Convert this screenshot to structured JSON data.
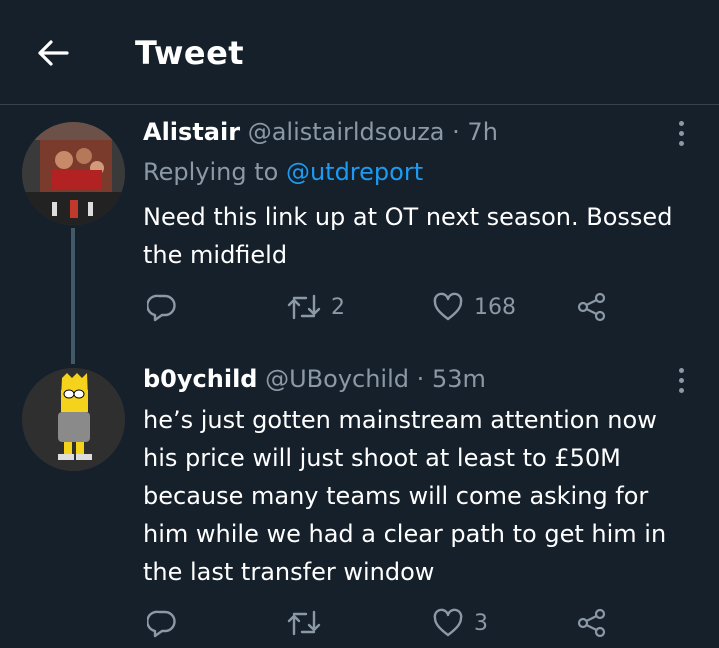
{
  "header": {
    "title": "Tweet",
    "back_icon": "arrow-left-icon"
  },
  "tweets": [
    {
      "name": "Alistair",
      "handle": "@alistairldsouza",
      "sep": "·",
      "time": "7h",
      "replying_prefix": "Replying to",
      "replying_handle": "@utdreport",
      "text_lines": [
        "Need this link up at OT next season. Bossed",
        "the midfield"
      ],
      "reply_count": "",
      "retweet_count": "2",
      "like_count": "168"
    },
    {
      "name": "b0ychild",
      "handle": "@UBoychild",
      "sep": "·",
      "time": "53m",
      "text_lines": [
        "he’s just gotten mainstream attention now",
        "his price will just shoot at least to £50M",
        "because many teams will come asking for",
        "him while we had a clear path to get him in",
        "the last transfer window"
      ],
      "reply_count": "",
      "retweet_count": "",
      "like_count": "3"
    }
  ],
  "colors": {
    "background": "#15202b",
    "muted": "#8b98a5",
    "link": "#1d9bf0",
    "divider": "#38444d"
  }
}
